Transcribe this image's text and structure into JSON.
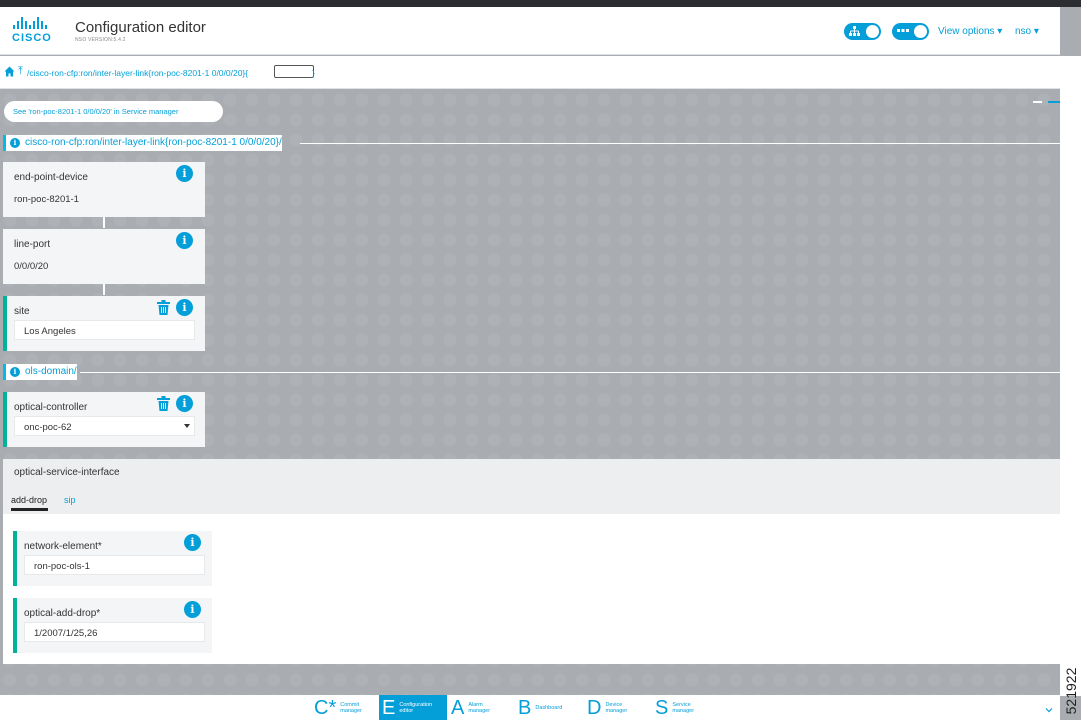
{
  "header": {
    "logo_text": "CISCO",
    "title": "Configuration editor",
    "version": "NSO VERSION:5.4.2",
    "view_options_label": "View options ▾",
    "user_label": "nso ▾"
  },
  "breadcrumb": {
    "path": "/cisco-ron-cfp:ron/inter-layer-link{ron-poc-8201-1 0/0/0/20}{",
    "close": "}"
  },
  "service_link": "See 'ron-poc-8201-1 0/0/0/20' in Service manager",
  "sections": {
    "main_path": "cisco-ron-cfp:ron/inter-layer-link{ron-poc-8201-1 0/0/0/20}/",
    "ols_path": "ols-domain/"
  },
  "leaves": {
    "end_point_device": {
      "name": "end-point-device",
      "value": "ron-poc-8201-1"
    },
    "line_port": {
      "name": "line-port",
      "value": "0/0/0/20"
    },
    "site": {
      "name": "site",
      "value": "Los Angeles"
    },
    "optical_controller": {
      "name": "optical-controller",
      "value": "onc-poc-62"
    }
  },
  "osi": {
    "title": "optical-service-interface",
    "tabs": [
      "add-drop",
      "sip"
    ],
    "network_element": {
      "name": "network-element*",
      "value": "ron-poc-ols-1"
    },
    "optical_add_drop": {
      "name": "optical-add-drop*",
      "value": "1/2007/1/25,26"
    }
  },
  "bottom_nav": [
    {
      "letter": "C*",
      "line1": "Commit",
      "line2": "manager"
    },
    {
      "letter": "E",
      "line1": "Configuration",
      "line2": "editor"
    },
    {
      "letter": "A",
      "line1": "Alarm",
      "line2": "manager"
    },
    {
      "letter": "B",
      "line1": "Dashboard",
      "line2": ""
    },
    {
      "letter": "D",
      "line1": "Device",
      "line2": "manager"
    },
    {
      "letter": "S",
      "line1": "Service",
      "line2": "manager"
    }
  ],
  "figure_id": "521922",
  "colors": {
    "accent": "#049fd9",
    "edited": "#00b398"
  }
}
